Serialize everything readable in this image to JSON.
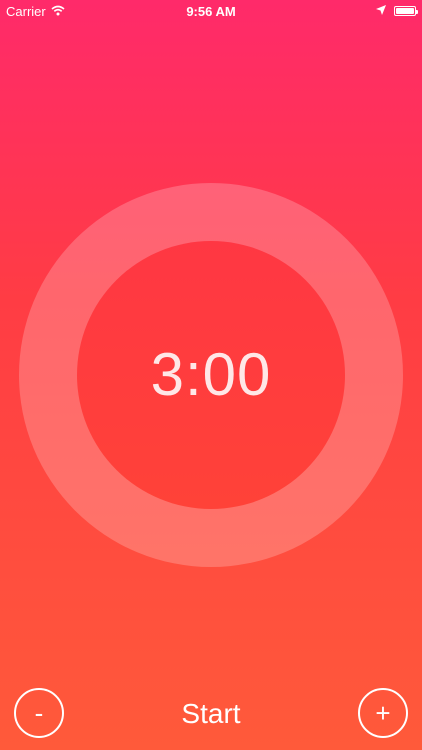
{
  "status_bar": {
    "carrier": "Carrier",
    "time": "9:56 AM",
    "icons": [
      "wifi-icon",
      "location-arrow-icon",
      "battery-icon"
    ]
  },
  "timer": {
    "display": "3:00"
  },
  "controls": {
    "decrement_label": "-",
    "start_label": "Start",
    "increment_label": "+"
  },
  "colors": {
    "gradient_top": "#ff2a6a",
    "gradient_middle": "#ff3c44",
    "gradient_bottom": "#ff5a3a",
    "ring": "rgba(255,255,255,0.22)",
    "text": "#ffffff"
  }
}
